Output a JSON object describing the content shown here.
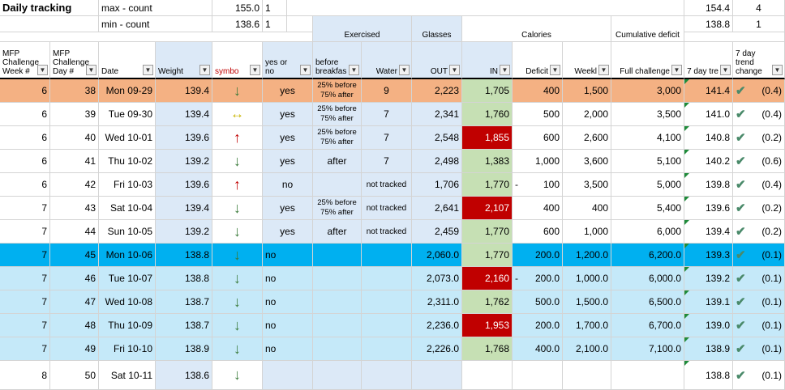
{
  "title": "Daily tracking",
  "summary": {
    "max_label": "max - count",
    "min_label": "min - count",
    "max_value": "155.0",
    "max_count": "1",
    "min_value": "138.6",
    "min_count": "1",
    "trend_max": "154.4",
    "trend_max_count": "4",
    "trend_min": "138.8",
    "trend_min_count": "1"
  },
  "groups": {
    "exercised": "Exercised",
    "glasses": "Glasses",
    "calories": "Calories",
    "cumulative": "Cumulative deficit"
  },
  "columns": [
    "MFP Challenge Week #",
    "MFP Challenge Day #",
    "Date",
    "Weight",
    "symbo",
    "yes or no",
    "before breakfas",
    "Water",
    "OUT",
    "IN",
    "Deficit",
    "Weekl",
    "Full challenge",
    "7 day tre",
    "7 day trend change"
  ],
  "rows": [
    {
      "week": "6",
      "day": "38",
      "date": "Mon 09-29",
      "weight": "139.4",
      "symbol": "down",
      "ex": "yes",
      "before": "25% before 75% after",
      "water": "9",
      "out": "2,223",
      "in": "1,705",
      "in_color": "#c6e0b4",
      "dash": "",
      "deficit": "400",
      "weekly": "1,500",
      "full": "3,000",
      "trend": "141.4",
      "change": "(0.4)",
      "row_color": "#f4b183"
    },
    {
      "week": "6",
      "day": "39",
      "date": "Tue 09-30",
      "weight": "139.4",
      "symbol": "same",
      "ex": "yes",
      "before": "25% before 75% after",
      "water": "7",
      "out": "2,341",
      "in": "1,760",
      "in_color": "#c6e0b4",
      "dash": "",
      "deficit": "500",
      "weekly": "2,000",
      "full": "3,500",
      "trend": "141.0",
      "change": "(0.4)",
      "row_color": "#ffffff"
    },
    {
      "week": "6",
      "day": "40",
      "date": "Wed 10-01",
      "weight": "139.6",
      "symbol": "up",
      "ex": "yes",
      "before": "25% before 75% after",
      "water": "7",
      "out": "2,548",
      "in": "1,855",
      "in_color": "#c00000",
      "dash": "",
      "deficit": "600",
      "weekly": "2,600",
      "full": "4,100",
      "trend": "140.8",
      "change": "(0.2)",
      "row_color": "#ffffff"
    },
    {
      "week": "6",
      "day": "41",
      "date": "Thu 10-02",
      "weight": "139.2",
      "symbol": "down",
      "ex": "yes",
      "before": "after",
      "water": "7",
      "out": "2,498",
      "in": "1,383",
      "in_color": "#c6e0b4",
      "dash": "",
      "deficit": "1,000",
      "weekly": "3,600",
      "full": "5,100",
      "trend": "140.2",
      "change": "(0.6)",
      "row_color": "#ffffff"
    },
    {
      "week": "6",
      "day": "42",
      "date": "Fri 10-03",
      "weight": "139.6",
      "symbol": "up",
      "ex": "no",
      "before": "",
      "water": "not tracked",
      "out": "1,706",
      "in": "1,770",
      "in_color": "#c6e0b4",
      "dash": "-",
      "deficit": "100",
      "weekly": "3,500",
      "full": "5,000",
      "trend": "139.8",
      "change": "(0.4)",
      "row_color": "#ffffff"
    },
    {
      "week": "7",
      "day": "43",
      "date": "Sat 10-04",
      "weight": "139.4",
      "symbol": "down",
      "ex": "yes",
      "before": "25% before 75% after",
      "water": "not tracked",
      "out": "2,641",
      "in": "2,107",
      "in_color": "#c00000",
      "dash": "",
      "deficit": "400",
      "weekly": "400",
      "full": "5,400",
      "trend": "139.6",
      "change": "(0.2)",
      "row_color": "#ffffff"
    },
    {
      "week": "7",
      "day": "44",
      "date": "Sun 10-05",
      "weight": "139.2",
      "symbol": "down",
      "ex": "yes",
      "before": "after",
      "water": "not tracked",
      "out": "2,459",
      "in": "1,770",
      "in_color": "#c6e0b4",
      "dash": "",
      "deficit": "600",
      "weekly": "1,000",
      "full": "6,000",
      "trend": "139.4",
      "change": "(0.2)",
      "row_color": "#ffffff"
    },
    {
      "week": "7",
      "day": "45",
      "date": "Mon 10-06",
      "weight": "138.8",
      "symbol": "down",
      "ex": "no",
      "before": "",
      "water": "",
      "out": "2,060.0",
      "in": "1,770",
      "in_color": "#c6e0b4",
      "dash": "",
      "deficit": "200.0",
      "weekly": "1,200.0",
      "full": "6,200.0",
      "trend": "139.3",
      "change": "(0.1)",
      "row_color": "#00b0f0"
    },
    {
      "week": "7",
      "day": "46",
      "date": "Tue 10-07",
      "weight": "138.8",
      "symbol": "down",
      "ex": "no",
      "before": "",
      "water": "",
      "out": "2,073.0",
      "in": "2,160",
      "in_color": "#c00000",
      "dash": "-",
      "deficit": "200.0",
      "weekly": "1,000.0",
      "full": "6,000.0",
      "trend": "139.2",
      "change": "(0.1)",
      "row_color": "#c5e9f9"
    },
    {
      "week": "7",
      "day": "47",
      "date": "Wed 10-08",
      "weight": "138.7",
      "symbol": "down",
      "ex": "no",
      "before": "",
      "water": "",
      "out": "2,311.0",
      "in": "1,762",
      "in_color": "#c6e0b4",
      "dash": "",
      "deficit": "500.0",
      "weekly": "1,500.0",
      "full": "6,500.0",
      "trend": "139.1",
      "change": "(0.1)",
      "row_color": "#c5e9f9"
    },
    {
      "week": "7",
      "day": "48",
      "date": "Thu 10-09",
      "weight": "138.7",
      "symbol": "down",
      "ex": "no",
      "before": "",
      "water": "",
      "out": "2,236.0",
      "in": "1,953",
      "in_color": "#c00000",
      "dash": "",
      "deficit": "200.0",
      "weekly": "1,700.0",
      "full": "6,700.0",
      "trend": "139.0",
      "change": "(0.1)",
      "row_color": "#c5e9f9"
    },
    {
      "week": "7",
      "day": "49",
      "date": "Fri 10-10",
      "weight": "138.9",
      "symbol": "down",
      "ex": "no",
      "before": "",
      "water": "",
      "out": "2,226.0",
      "in": "1,768",
      "in_color": "#c6e0b4",
      "dash": "",
      "deficit": "400.0",
      "weekly": "2,100.0",
      "full": "7,100.0",
      "trend": "138.9",
      "change": "(0.1)",
      "row_color": "#c5e9f9"
    },
    {
      "week": "8",
      "day": "50",
      "date": "Sat 10-11",
      "weight": "138.6",
      "symbol": "down",
      "ex": "",
      "before": "",
      "water": "",
      "out": "",
      "in": "",
      "in_color": "#ffffff",
      "dash": "",
      "deficit": "",
      "weekly": "",
      "full": "",
      "trend": "138.8",
      "change": "(0.1)",
      "row_color": "#ffffff"
    }
  ],
  "colors": {
    "col_blue": "#dce9f7",
    "grid": "#d4d4d4"
  },
  "icons": {
    "down": "arrow-down-icon",
    "up": "arrow-up-icon",
    "same": "arrow-left-right-icon",
    "check": "check-icon",
    "dropdown": "filter-dropdown-icon"
  }
}
